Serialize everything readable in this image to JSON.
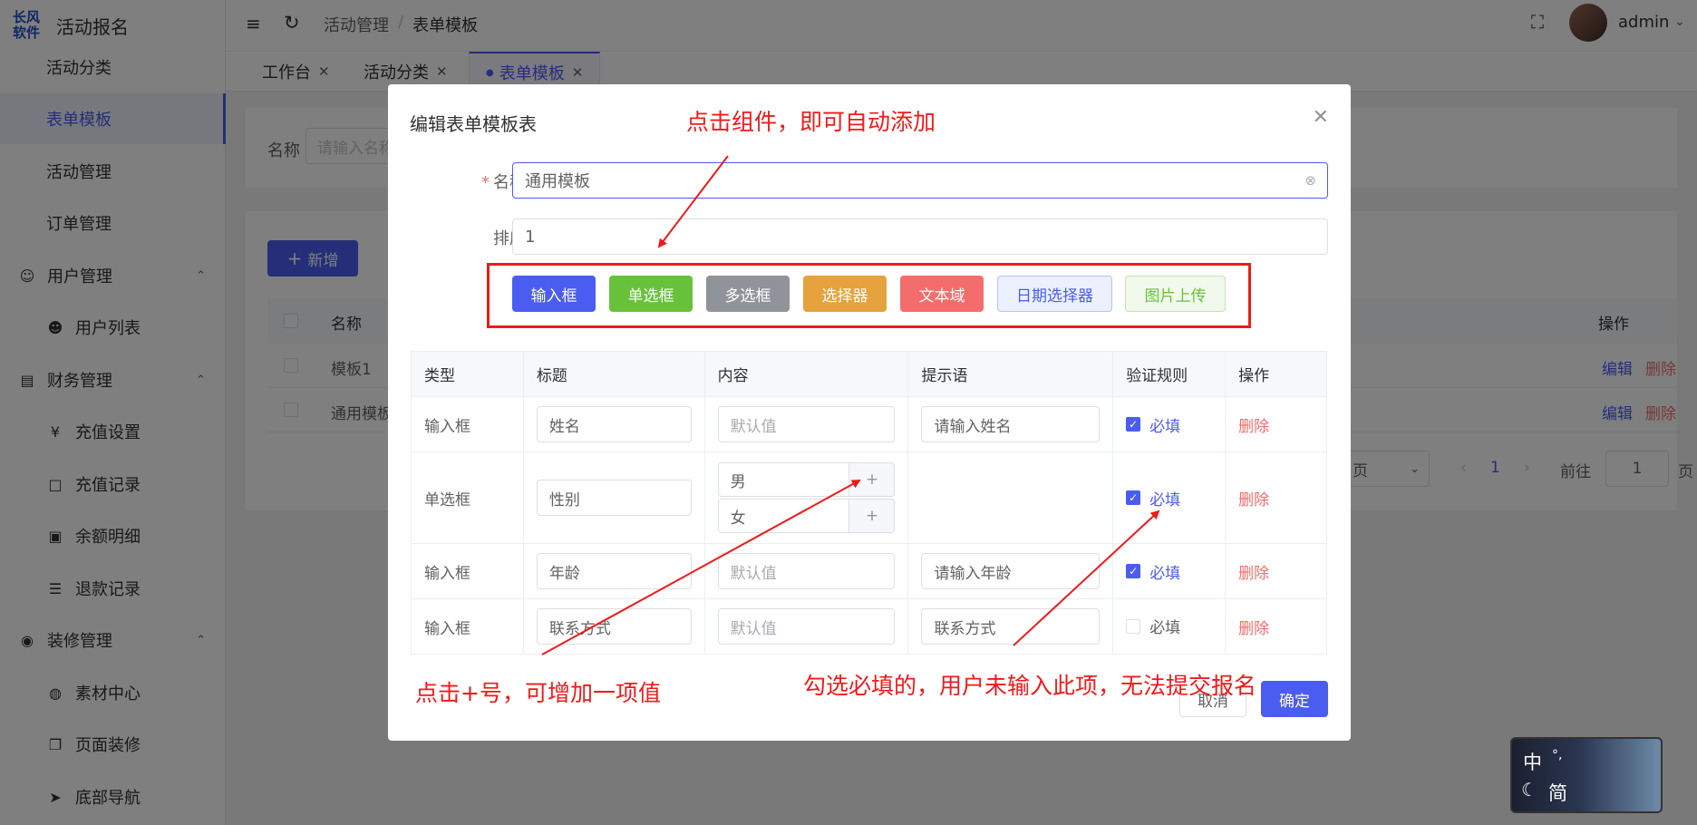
{
  "app": {
    "logo_line1": "长风",
    "logo_line2": "软件",
    "title": "活动报名"
  },
  "sidebar": {
    "items": [
      {
        "label": "活动分类"
      },
      {
        "label": "表单模板"
      },
      {
        "label": "活动管理"
      },
      {
        "label": "订单管理"
      },
      {
        "label": "用户管理"
      },
      {
        "label": "用户列表"
      },
      {
        "label": "财务管理"
      },
      {
        "label": "充值设置"
      },
      {
        "label": "充值记录"
      },
      {
        "label": "余额明细"
      },
      {
        "label": "退款记录"
      },
      {
        "label": "装修管理"
      },
      {
        "label": "素材中心"
      },
      {
        "label": "页面装修"
      },
      {
        "label": "底部导航"
      }
    ]
  },
  "header": {
    "breadcrumb_1": "活动管理",
    "breadcrumb_sep": "/",
    "breadcrumb_2": "表单模板",
    "user": "admin"
  },
  "tabs": [
    {
      "label": "工作台"
    },
    {
      "label": "活动分类"
    },
    {
      "label": "表单模板"
    }
  ],
  "page": {
    "search_label": "名称",
    "search_placeholder": "请输入名称",
    "add_button": "新增",
    "col_name": "名称",
    "col_ops": "操作",
    "rows": [
      {
        "name": "模板1"
      },
      {
        "name": "通用模板"
      }
    ],
    "edit": "编辑",
    "delete": "删除",
    "page_suffix": "页",
    "current_page": "1",
    "goto": "前往",
    "goto_value": "1",
    "goto_suffix": "页"
  },
  "dialog": {
    "title": "编辑表单模板表",
    "name_label": "名称",
    "name_value": "通用模板",
    "sort_label": "排序",
    "sort_value": "1",
    "components": [
      {
        "label": "输入框",
        "color": "#4b5cf0"
      },
      {
        "label": "单选框",
        "color": "#67c23a"
      },
      {
        "label": "多选框",
        "color": "#909399"
      },
      {
        "label": "选择器",
        "color": "#e6a23c"
      },
      {
        "label": "文本域",
        "color": "#f56c6c"
      },
      {
        "label": "日期选择器",
        "color": "#4b5cf0"
      },
      {
        "label": "图片上传",
        "color": "#67c23a"
      }
    ],
    "table": {
      "headers": [
        "类型",
        "标题",
        "内容",
        "提示语",
        "验证规则",
        "操作"
      ],
      "default_placeholder": "默认值",
      "required": "必填",
      "delete": "删除",
      "rows": [
        {
          "type": "输入框",
          "title": "姓名",
          "hint": "请输入姓名",
          "checked": true
        },
        {
          "type": "单选框",
          "title": "性别",
          "options": [
            "男",
            "女"
          ],
          "checked": true
        },
        {
          "type": "输入框",
          "title": "年龄",
          "hint": "请输入年龄",
          "checked": true
        },
        {
          "type": "输入框",
          "title": "联系方式",
          "hint": "联系方式",
          "checked": false
        }
      ]
    },
    "cancel": "取消",
    "confirm": "确定"
  },
  "annotations": {
    "top": "点击组件，即可自动添加",
    "left": "点击+号，可增加一项值",
    "right": "勾选必填的，用户未输入此项，无法提交报名"
  },
  "ime": {
    "lang": "中",
    "mode": "简"
  }
}
